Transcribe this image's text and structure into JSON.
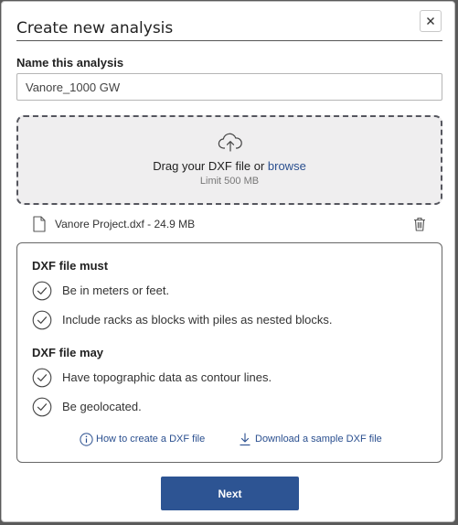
{
  "dialog": {
    "title": "Create new analysis",
    "close_icon": "close-icon"
  },
  "name_field": {
    "label": "Name this analysis",
    "value": "Vanore_1000 GW"
  },
  "dropzone": {
    "icon": "cloud-upload-icon",
    "prompt": "Drag your DXF file or ",
    "browse_label": "browse",
    "limit": "Limit 500 MB"
  },
  "uploaded_file": {
    "icon": "file-icon",
    "name": "Vanore Project.dxf",
    "size": " - 24.9 MB",
    "delete_icon": "trash-icon"
  },
  "requirements": {
    "must_heading": "DXF file must",
    "must_items": [
      "Be in meters or feet.",
      "Include racks as blocks with piles as nested blocks."
    ],
    "may_heading": "DXF file may",
    "may_items": [
      "Have topographic data as contour lines.",
      "Be geolocated."
    ],
    "item_icon": "check-circle-icon",
    "links": [
      {
        "label": "How to create a DXF file",
        "icon": "info-circle-icon"
      },
      {
        "label": "Download a sample DXF file",
        "icon": "download-icon"
      }
    ]
  },
  "footer": {
    "next_label": "Next"
  },
  "colors": {
    "primary": "#2d5493",
    "link": "#2a4f8f",
    "dropzone_bg": "#efeeef",
    "backdrop": "#5a5a5a"
  }
}
